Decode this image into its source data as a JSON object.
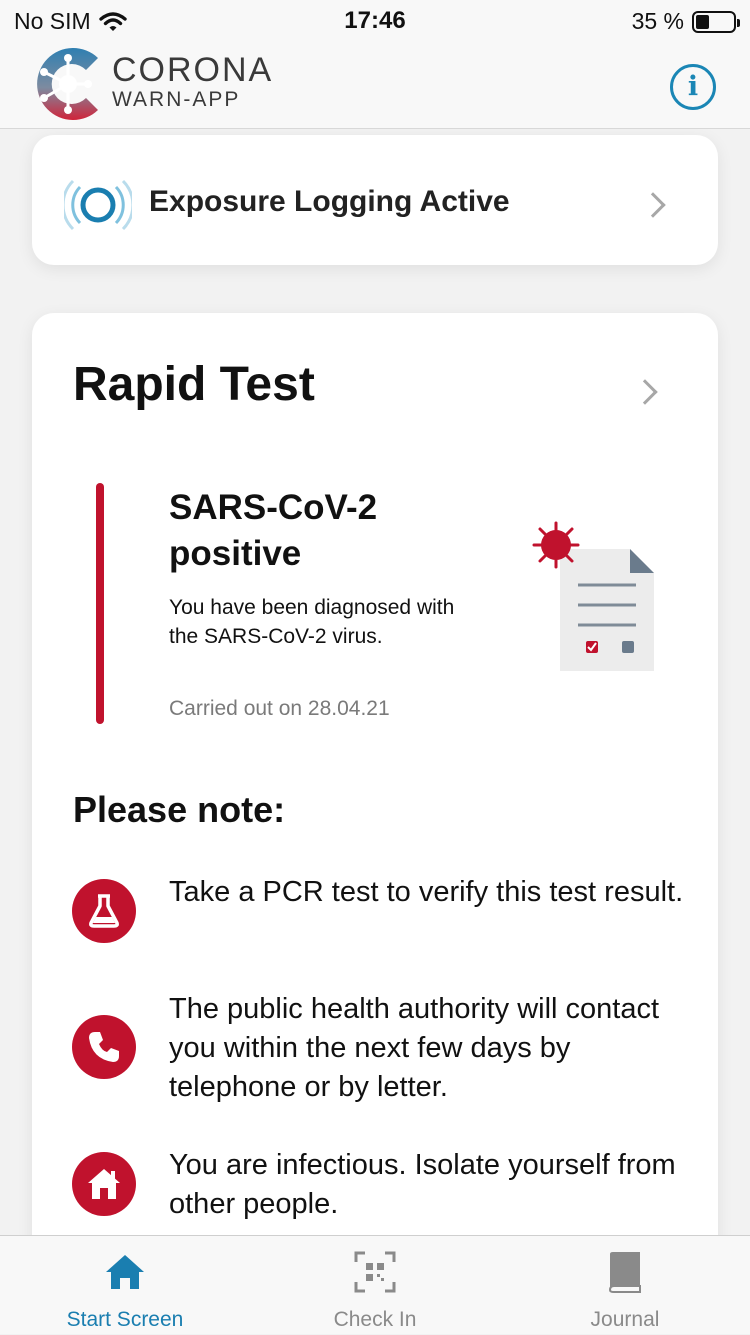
{
  "status_bar": {
    "carrier": "No SIM",
    "time": "17:46",
    "battery_text": "35 %",
    "battery_level": 0.35
  },
  "header": {
    "logo_title": "CORONA",
    "logo_subtitle": "WARN-APP",
    "info_icon": "info-icon",
    "info_symbol": "i"
  },
  "exposure": {
    "label": "Exposure Logging Active",
    "icon": "exposure-active-icon"
  },
  "test": {
    "title": "Rapid Test",
    "result_title": "SARS-CoV-2 positive",
    "result_description": "You have been diagnosed with the SARS-CoV-2 virus.",
    "result_date": "Carried out on 28.04.21",
    "accent_color": "#c0122d"
  },
  "notes": {
    "title": "Please note:",
    "items": [
      {
        "icon": "flask-icon",
        "text": "Take a PCR test to verify this test result."
      },
      {
        "icon": "phone-icon",
        "text": "The public health authority will contact you within the next few days by telephone or by letter."
      },
      {
        "icon": "home-icon",
        "text": "You are infectious. Isolate yourself from other people."
      }
    ]
  },
  "tabs": [
    {
      "label": "Start Screen",
      "icon": "home-icon",
      "active": true
    },
    {
      "label": "Check In",
      "icon": "qr-code-icon",
      "active": false
    },
    {
      "label": "Journal",
      "icon": "book-icon",
      "active": false
    }
  ],
  "colors": {
    "brand_blue": "#1a7eb0",
    "alert_red": "#c0122d"
  }
}
